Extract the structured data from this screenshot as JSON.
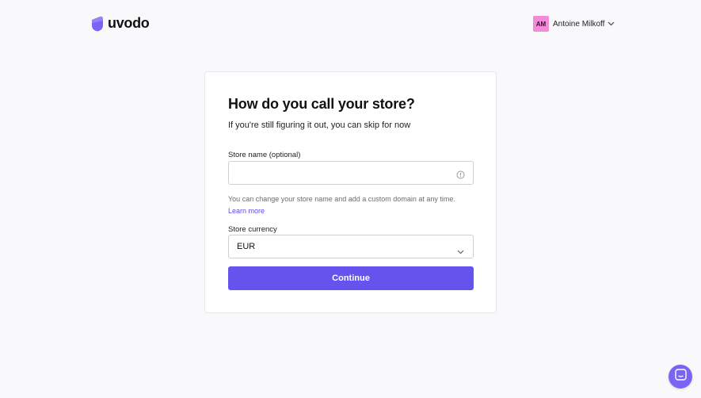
{
  "brand": {
    "name": "uvodo",
    "logo_icon": "shield-logo-icon",
    "accent": "#6653ee"
  },
  "user": {
    "initials": "AM",
    "name": "Antoine Milkoff",
    "avatar_color": "#f38bd9",
    "menu_icon": "chevron-down-icon"
  },
  "form": {
    "title": "How do you call your store?",
    "subtitle": "If you're still figuring it out, you can skip for now",
    "store_name_label": "Store name (optional)",
    "store_name_value": "",
    "store_name_placeholder": "",
    "store_name_icon": "info-icon",
    "helper_text": "You can change your store name and add a custom domain at any time.",
    "learn_more": "Learn more",
    "currency_label": "Store currency",
    "currency_value": "EUR",
    "continue_label": "Continue"
  },
  "support": {
    "icon": "chat-icon"
  }
}
